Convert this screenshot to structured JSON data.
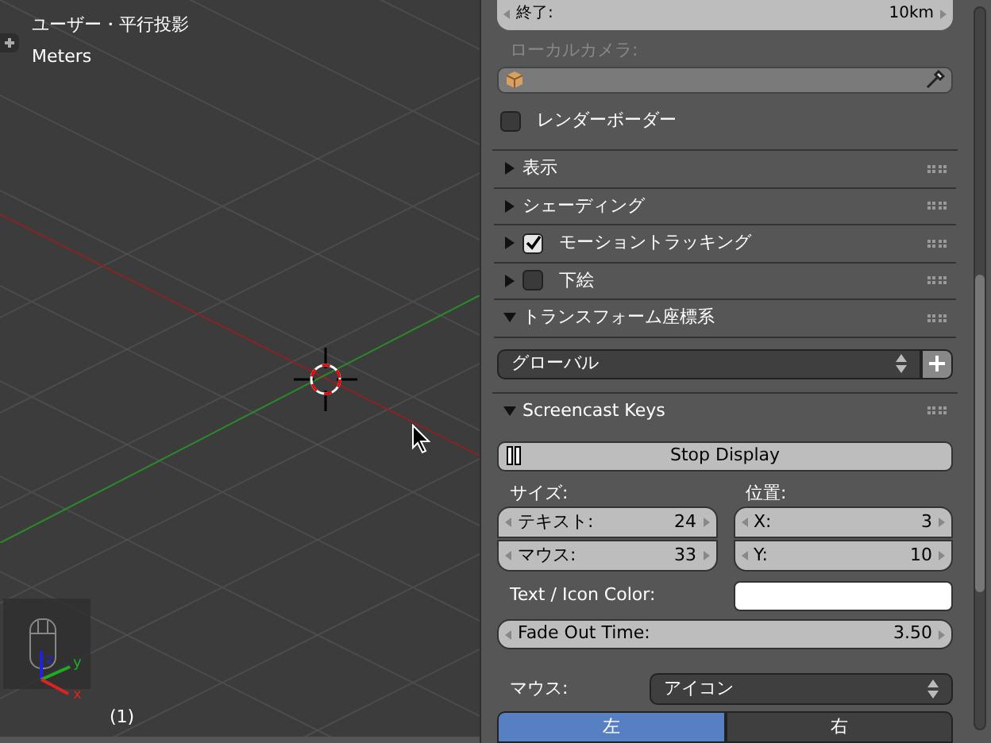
{
  "viewport": {
    "view_name": "ユーザー・平行投影",
    "units": "Meters",
    "frame": "(1)",
    "axis_labels": [
      "z",
      "y",
      "x"
    ]
  },
  "panel": {
    "clip_field": {
      "label": "終了:",
      "value": "10km"
    },
    "local_camera": {
      "label": "ローカルカメラ:"
    },
    "render_border": {
      "label": "レンダーボーダー",
      "checked": false
    },
    "sections": [
      {
        "label": "表示",
        "expanded": false
      },
      {
        "label": "シェーディング",
        "expanded": false
      },
      {
        "label": "モーショントラッキング",
        "expanded": false,
        "checked": true
      },
      {
        "label": "下絵",
        "expanded": false,
        "checked": false
      },
      {
        "label": "トランスフォーム座標系",
        "expanded": true
      }
    ],
    "orientation_dropdown": {
      "value": "グローバル"
    },
    "screencast": {
      "title": "Screencast Keys",
      "expanded": true,
      "button": "Stop Display",
      "size_label": "サイズ:",
      "position_label": "位置:",
      "size_fields": [
        {
          "label": "テキスト:",
          "value": "24"
        },
        {
          "label": "マウス:",
          "value": "33"
        }
      ],
      "position_fields": [
        {
          "label": "X:",
          "value": "3"
        },
        {
          "label": "Y:",
          "value": "10"
        }
      ],
      "color_label": "Text / Icon Color:",
      "color": "#ffffff",
      "fade": {
        "label": "Fade Out Time:",
        "value": "3.50"
      },
      "mouse_label": "マウス:",
      "mouse_value": "アイコン",
      "sides": [
        {
          "label": "左",
          "selected": true
        },
        {
          "label": "右",
          "selected": false
        }
      ]
    }
  }
}
